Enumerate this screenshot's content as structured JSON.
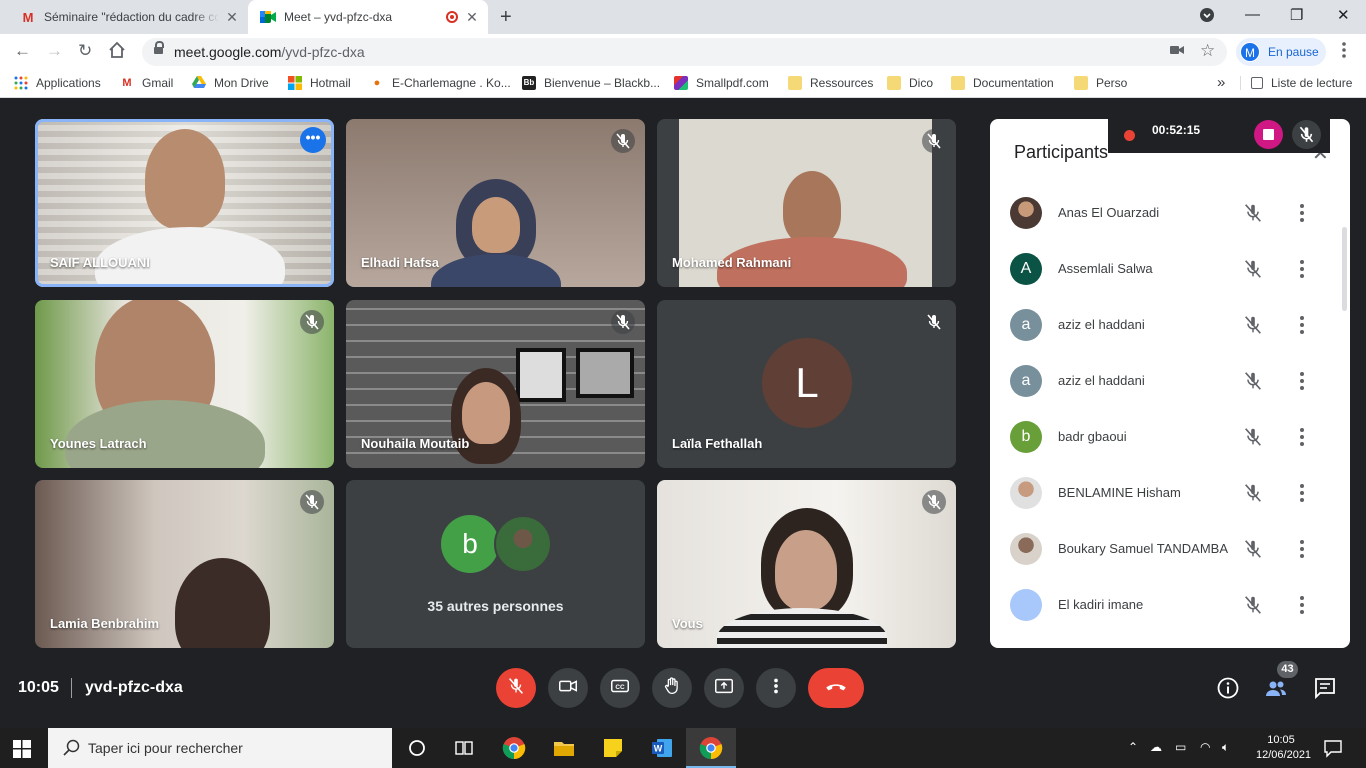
{
  "browser": {
    "tabs": [
      {
        "title": "Séminaire \"rédaction du cadre co",
        "icon": "gmail-icon"
      },
      {
        "title": "Meet – yvd-pfzc-dxa",
        "icon": "meet-icon"
      }
    ],
    "url_host": "meet.google.com",
    "url_path": "/yvd-pfzc-dxa",
    "profile_initial": "M",
    "profile_label": "En pause",
    "bookmarks": [
      "Applications",
      "Gmail",
      "Mon Drive",
      "Hotmail",
      "E-Charlemagne . Ko...",
      "Bienvenue – Blackb...",
      "Smallpdf.com",
      "Ressources",
      "Dico",
      "Documentation",
      "Perso"
    ],
    "bookmarks_overflow": "»",
    "reading_list": "Liste de lecture"
  },
  "meet": {
    "tiles": [
      {
        "name": "SAIF ALLOUANI",
        "active": true
      },
      {
        "name": "Elhadi Hafsa",
        "muted": true
      },
      {
        "name": "Mohamed Rahmani",
        "muted": true
      },
      {
        "name": "Younes Latrach",
        "muted": true
      },
      {
        "name": "Nouhaila Moutaib",
        "muted": true
      },
      {
        "name": "Laïla Fethallah",
        "initial": "L",
        "muted": true
      },
      {
        "name": "Lamia Benbrahim",
        "muted": true
      },
      {
        "others_label": "35 autres personnes",
        "initial": "b"
      },
      {
        "name": "Vous",
        "muted": true
      }
    ],
    "recording_time": "00:52:15",
    "panel_title": "Participants",
    "participants": [
      {
        "name": "Anas El Ouarzadi",
        "avatar": "photo"
      },
      {
        "name": "Assemlali Salwa",
        "initial": "A",
        "color": "#0b5345"
      },
      {
        "name": "aziz el haddani",
        "initial": "a",
        "color": "#78909c"
      },
      {
        "name": "aziz el haddani",
        "initial": "a",
        "color": "#78909c"
      },
      {
        "name": "badr gbaoui",
        "initial": "b",
        "color": "#689f38"
      },
      {
        "name": "BENLAMINE Hisham",
        "avatar": "photo"
      },
      {
        "name": "Boukary Samuel TANDAMBA",
        "avatar": "photo"
      },
      {
        "name": "El kadiri imane",
        "avatar": "light-blue"
      }
    ],
    "clock": "10:05",
    "meeting_code": "yvd-pfzc-dxa",
    "participant_count": "43"
  },
  "taskbar": {
    "search_placeholder": "Taper ici pour rechercher",
    "time": "10:05",
    "date": "12/06/2021"
  }
}
